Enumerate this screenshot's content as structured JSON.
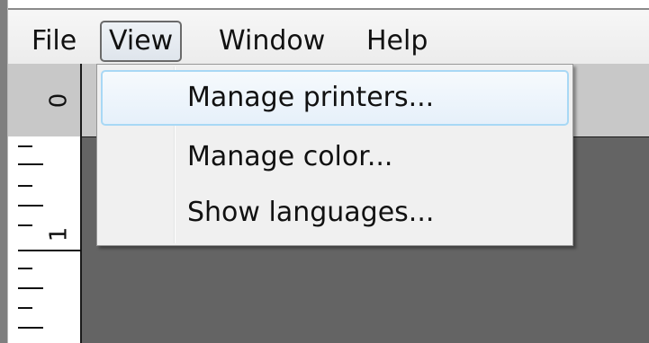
{
  "menubar": {
    "items": [
      {
        "label": "File"
      },
      {
        "label": "View"
      },
      {
        "label": "Window"
      },
      {
        "label": "Help"
      }
    ],
    "active_index": 1
  },
  "ruler": {
    "top_label": "0",
    "left_label": "1"
  },
  "view_menu": {
    "items": [
      {
        "label": "Manage printers..."
      },
      {
        "label": "Manage color..."
      },
      {
        "label": "Show languages..."
      }
    ],
    "highlighted_index": 0
  },
  "colors": {
    "workspace": "#646464",
    "ruler": "#c8c8c8",
    "menu_background": "#f0f0f0",
    "highlight_border": "#a8d8f5"
  }
}
